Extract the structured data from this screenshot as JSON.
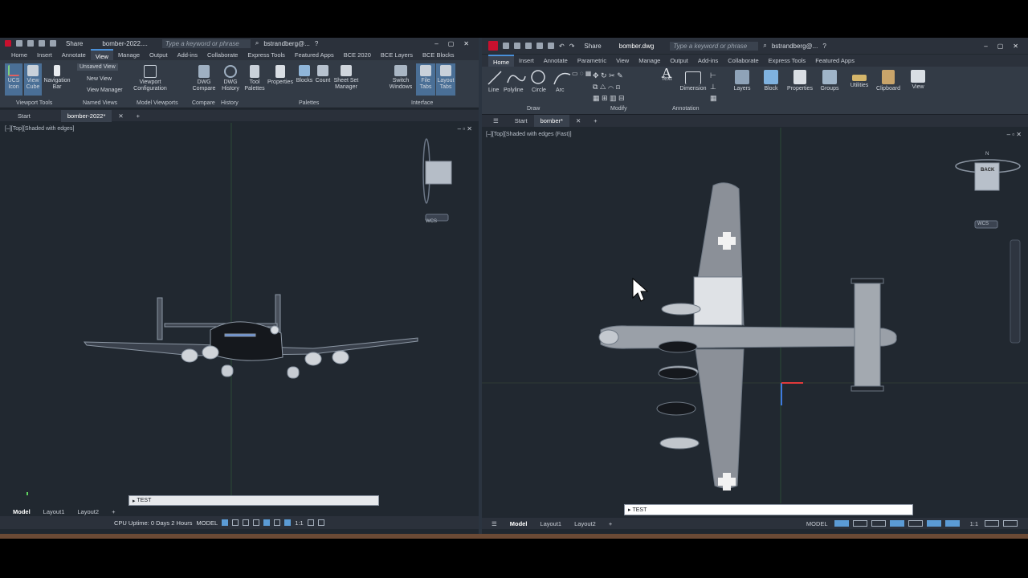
{
  "left": {
    "share": "Share",
    "doc_title": "bomber-2022....",
    "search_placeholder": "Type a keyword or phrase",
    "user": "bstrandberg@...",
    "tabs": [
      "Home",
      "Insert",
      "Annotate",
      "View",
      "Manage",
      "Output",
      "Add-ins",
      "Collaborate",
      "Express Tools",
      "Featured Apps",
      "BCE 2020",
      "BCE Layers",
      "BCE Blocks"
    ],
    "active_tab": "View",
    "ribbon": {
      "ucs_icon": "UCS Icon",
      "view_cube": "View Cube",
      "nav_bar": "Navigation Bar",
      "unsaved_view": "Unsaved View",
      "new_view": "New View",
      "view_manager": "View Manager",
      "viewport_config": "Viewport Configuration",
      "dwg_compare": "DWG Compare",
      "dwg_history": "DWG History",
      "tool_palettes": "Tool Palettes",
      "properties": "Properties",
      "blocks": "Blocks",
      "count": "Count",
      "sheet_set": "Sheet Set Manager",
      "switch_windows": "Switch Windows",
      "file_tabs": "File Tabs",
      "layout_tabs": "Layout Tabs"
    },
    "panels": [
      "Viewport Tools",
      "Named Views",
      "Model Viewports",
      "Compare",
      "History",
      "Palettes",
      "Interface"
    ],
    "doc_tabs": [
      "Start",
      "bomber-2022*"
    ],
    "viewport_label": "[–][Top][Shaded with edges]",
    "wcs": "WCS",
    "command_value": "TEST",
    "layout_tabs": [
      "Model",
      "Layout1",
      "Layout2"
    ],
    "cpu": "CPU Uptime: 0 Days 2 Hours",
    "model": "MODEL",
    "scale": "1:1"
  },
  "right": {
    "share": "Share",
    "doc_title": "bomber.dwg",
    "search_placeholder": "Type a keyword or phrase",
    "user": "bstrandberg@...",
    "tabs": [
      "Home",
      "Insert",
      "Annotate",
      "Parametric",
      "View",
      "Manage",
      "Output",
      "Add-ins",
      "Collaborate",
      "Express Tools",
      "Featured Apps"
    ],
    "active_tab": "Home",
    "draw": [
      "Line",
      "Polyline",
      "Circle",
      "Arc"
    ],
    "text": "Text",
    "dimension": "Dimension",
    "big": [
      "Layers",
      "Block",
      "Properties",
      "Groups",
      "Utilities",
      "Clipboard",
      "View"
    ],
    "panels": [
      "Draw",
      "Modify",
      "Annotation"
    ],
    "doc_tabs": [
      "Start",
      "bomber*"
    ],
    "viewport_label": "[–][Top][Shaded with edges (Fast)]",
    "viewcube_face": "BACK",
    "compass_n": "N",
    "wcs": "WCS",
    "command_value": "TEST",
    "layout_tabs": [
      "Model",
      "Layout1",
      "Layout2"
    ],
    "model": "MODEL",
    "scale": "1:1"
  },
  "colors": {
    "accent": "#4a90d9",
    "canvas": "#212830",
    "autocad_red": "#c8102e"
  }
}
